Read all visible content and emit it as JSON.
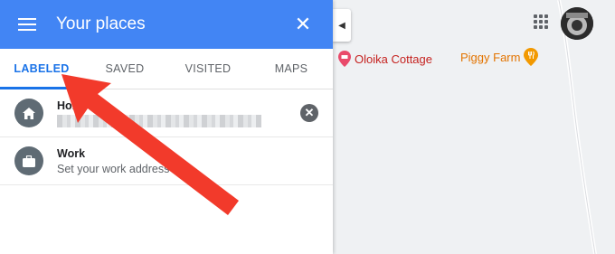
{
  "panel": {
    "title": "Your places",
    "tabs": [
      {
        "label": "LABELED",
        "active": true
      },
      {
        "label": "SAVED"
      },
      {
        "label": "VISITED"
      },
      {
        "label": "MAPS"
      }
    ],
    "items": [
      {
        "title": "Hom",
        "subtitle": "",
        "icon": "home-icon",
        "clearable": true
      },
      {
        "title": "Work",
        "subtitle": "Set your work address",
        "icon": "briefcase-icon"
      }
    ]
  },
  "map": {
    "pois": [
      {
        "label": "Oloika Cottage",
        "icon": "hotel-pin-icon",
        "color": "#e94a6a"
      },
      {
        "label": "Piggy Farm",
        "icon": "restaurant-pin-icon",
        "color": "#f29900"
      }
    ]
  },
  "colors": {
    "header": "#4285f4",
    "accent": "#1a73e8",
    "annotation_arrow": "#f23a2b"
  }
}
